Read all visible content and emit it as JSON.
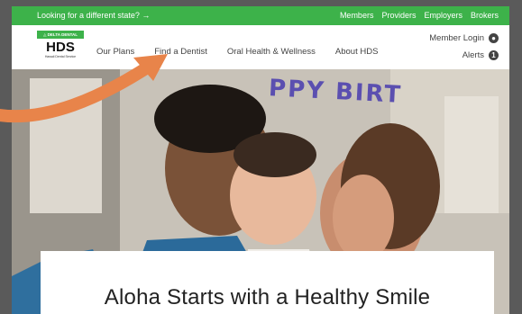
{
  "topbar": {
    "state_prompt": "Looking for a different state? →",
    "links": [
      "Members",
      "Providers",
      "Employers",
      "Brokers"
    ]
  },
  "logo": {
    "badge": "◬ DELTA DENTAL",
    "name": "HDS",
    "subtitle": "Hawaii Dental Service"
  },
  "nav": {
    "items": [
      "Our Plans",
      "Find a Dentist",
      "Oral Health & Wellness",
      "About HDS"
    ]
  },
  "utility": {
    "member_login": "Member Login",
    "alerts": "Alerts",
    "alert_count": "1"
  },
  "hero": {
    "banner_text": "PPY BIRT",
    "headline": "Aloha Starts with a Healthy Smile"
  },
  "colors": {
    "brand_green": "#3db24a",
    "arrow_orange": "#e8844a"
  }
}
